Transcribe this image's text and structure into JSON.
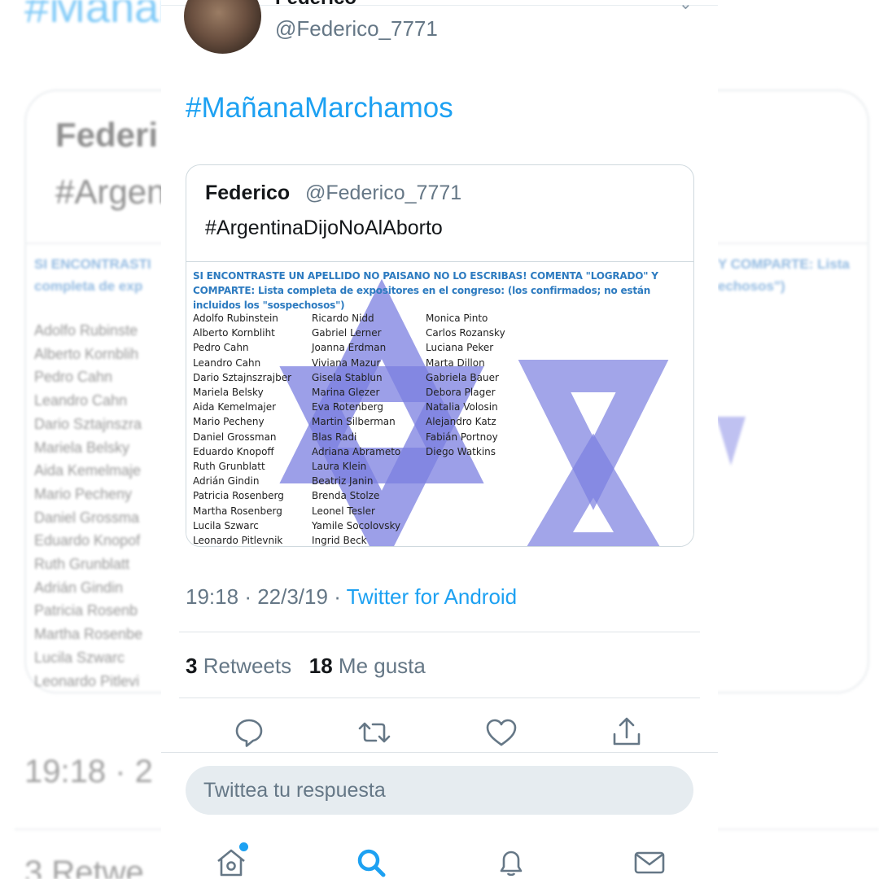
{
  "background": {
    "hashtag": "#Mañana",
    "name": "Federi",
    "hashtag2": "#Argen",
    "image_header_left_1": "SI ENCONTRASTI",
    "image_header_left_2": "completa de exp",
    "image_header_right_1": "Y COMPARTE: Lista",
    "image_header_right_2": "echosos\")",
    "names": [
      "Adolfo Rubinste",
      "Alberto Kornblih",
      "Pedro Cahn",
      "Leandro Cahn",
      "Dario Sztajnszra",
      "Mariela Belsky",
      "Aida Kemelmaje",
      "Mario Pecheny",
      "Daniel Grossma",
      "Eduardo Knopof",
      "Ruth Grunblatt",
      "Adrián Gindin",
      "Patricia Rosenb",
      "Martha Rosenbe",
      "Lucila Szwarc",
      "Leonardo Pitlevi"
    ],
    "time": "19:18 · 2",
    "retweets": "3 Retwe"
  },
  "tweet": {
    "author_name_cut": "Federico",
    "handle": "@Federico_7771",
    "text": "#MañanaMarchamos",
    "quoted": {
      "name": "Federico",
      "handle": "@Federico_7771",
      "text": "#ArgentinaDijoNoAlAborto",
      "image": {
        "header": "SI ENCONTRASTE UN APELLIDO NO PAISANO NO LO ESCRIBAS! COMENTA \"LOGRADO\" Y COMPARTE: Lista completa de expositores en el congreso: (los confirmados; no están incluidos los \"sospechosos\")",
        "column1": [
          "Adolfo Rubinstein",
          "Alberto Kornbliht",
          "Pedro Cahn",
          "Leandro Cahn",
          "Dario Sztajnszrajber",
          "Mariela Belsky",
          "Aida Kemelmajer",
          "Mario Pecheny",
          "Daniel Grossman",
          "Eduardo Knopoff",
          "Ruth Grunblatt",
          "Adrián Gindin",
          "Patricia Rosenberg",
          "Martha Rosenberg",
          "Lucila Szwarc",
          "Leonardo Pitlevnik"
        ],
        "column2": [
          "Ricardo Nidd",
          "Gabriel Lerner",
          "Joanna Erdman",
          "Viviana Mazur",
          "Gisela Stablun",
          "Marina Glezer",
          "Eva Rotenberg",
          "Martin Silberman",
          "Blas Radi",
          "Adriana Abrameto",
          "Laura Klein",
          "Beatriz Janin",
          "Brenda Stolze",
          "Leonel Tesler",
          "Yamile Socolovsky",
          "Ingrid Beck"
        ],
        "column3": [
          "Monica Pinto",
          "Carlos Rozansky",
          "Luciana Peker",
          "Marta Dillon",
          "Gabriela Bauer",
          "Debora Plager",
          "Natalia Volosin",
          "Alejandro Katz",
          "Fabián Portnoy",
          "Diego Watkins"
        ],
        "overlay_color": "#7b7fe0"
      }
    },
    "time": "19:18",
    "date": "22/3/19",
    "source": "Twitter for Android",
    "retweets_count": "3",
    "retweets_label": "Retweets",
    "likes_count": "18",
    "likes_label": "Me gusta",
    "actions": [
      "reply-icon",
      "retweet-icon",
      "like-icon",
      "share-icon"
    ]
  },
  "reply_box": {
    "placeholder": "Twittea tu respuesta"
  },
  "tabbar": [
    "home-icon",
    "search-icon",
    "notifications-icon",
    "messages-icon"
  ],
  "colors": {
    "accent": "#1da1f2",
    "secondary_text": "#657786",
    "border": "#dfe4e8"
  }
}
